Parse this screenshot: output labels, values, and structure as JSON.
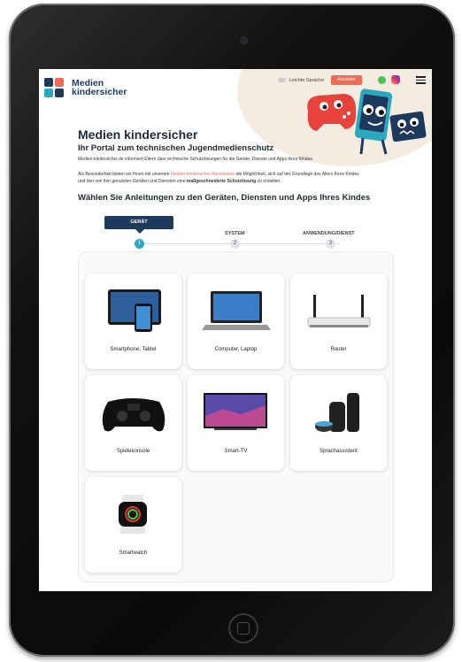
{
  "header": {
    "logo_line1": "Medien",
    "logo_line2": "kindersicher",
    "easy_language": "Leichte Sprache",
    "assistant_button": "Assistent"
  },
  "intro": {
    "title": "Medien kindersicher",
    "subtitle": "Ihr Portal zum technischen Jugendmedienschutz",
    "desc": "Medien-kindersicher.de informiert Eltern über technische Schutzlösungen für die Geräte, Dienste und Apps ihres Kindes.",
    "text_a": "Als Besonderheit bieten wir Ihnen mit unserem ",
    "link": "Medien-kindersicher-Assistenten",
    "text_b": " die Möglichkeit, sich auf der Grundlage des Alters Ihres Kindes und den von ihm genutzten Geräten und Diensten eine ",
    "bold": "maßgeschneiderte Schutzlösung",
    "text_c": " zu erstellen.",
    "heading": "Wählen Sie Anleitungen zu den Geräten, Diensten und Apps Ihres Kindes"
  },
  "steps": [
    {
      "label": "GERÄT",
      "number": "1",
      "active": true
    },
    {
      "label": "SYSTEM",
      "number": "2",
      "active": false
    },
    {
      "label": "ANWENDUNG/DIENST",
      "number": "3",
      "active": false
    }
  ],
  "devices": [
    {
      "label": "Smartphone, Tablet",
      "icon": "tablet-phone-icon"
    },
    {
      "label": "Computer, Laptop",
      "icon": "laptop-icon"
    },
    {
      "label": "Router",
      "icon": "router-icon"
    },
    {
      "label": "Spielekonsole",
      "icon": "gamepad-icon"
    },
    {
      "label": "Smart-TV",
      "icon": "tv-icon"
    },
    {
      "label": "Sprachassistent",
      "icon": "smart-speaker-icon"
    },
    {
      "label": "Smartwatch",
      "icon": "smartwatch-icon"
    }
  ],
  "colors": {
    "accent_orange": "#ef6b53",
    "navy": "#1d3a5c",
    "step_teal": "#2aa8bf"
  }
}
